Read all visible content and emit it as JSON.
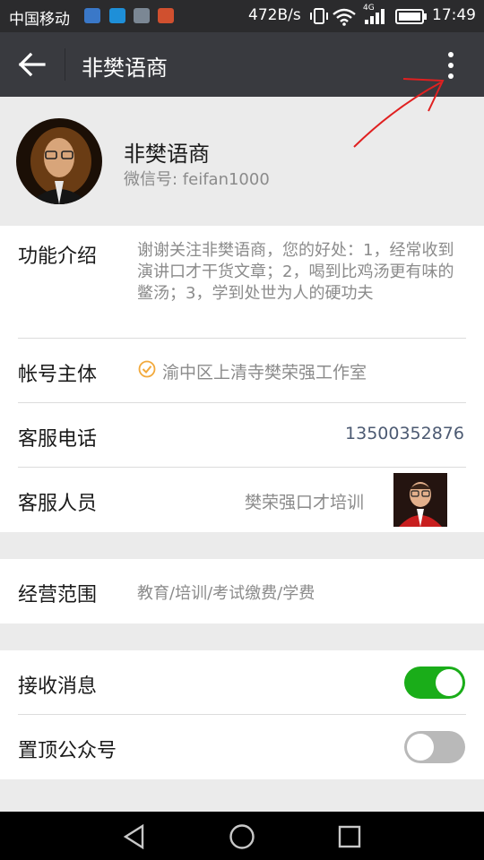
{
  "status_bar": {
    "carrier": "中国移动",
    "net_speed": "472B/s",
    "time": "17:49",
    "network_badge": "4G"
  },
  "nav": {
    "title": "非樊语商",
    "back_icon": "arrow-left-icon",
    "more_icon": "more-vertical-icon"
  },
  "profile": {
    "name": "非樊语商",
    "wechat_id": "微信号: feifan1000"
  },
  "info": {
    "intro_label": "功能介绍",
    "intro_text": "谢谢关注非樊语商，您的好处：1，经常收到演讲口才干货文章；2，喝到比鸡汤更有味的鳖汤；3，学到处世为人的硬功夫",
    "account_label": "帐号主体",
    "account_value": "渝中区上清寺樊荣强工作室",
    "phone_label": "客服电话",
    "phone_value": "13500352876",
    "staff_label": "客服人员",
    "staff_value": "樊荣强口才培训"
  },
  "business": {
    "scope_label": "经营范围",
    "scope_value": "教育/培训/考试缴费/学费"
  },
  "settings": {
    "receive_label": "接收消息",
    "receive_on": true,
    "pin_label": "置顶公众号",
    "pin_on": false
  },
  "colors": {
    "nav_bar": "#393a3f",
    "toggle_on": "#1aad19",
    "verified": "#f2a93b",
    "phone_link": "#4c5a72",
    "annotation": "#e02020"
  }
}
